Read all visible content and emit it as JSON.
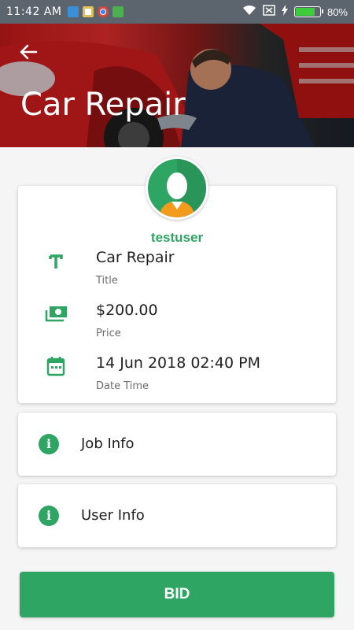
{
  "status_bar": {
    "time": "11:42 AM",
    "battery_pct": "80%",
    "battery_level": 0.8,
    "icons": [
      "usb-icon",
      "slack-icon",
      "chrome-icon",
      "android-icon",
      "wifi-icon",
      "no-sim-icon",
      "charging-icon",
      "battery-icon"
    ]
  },
  "header": {
    "title": "Car Repair",
    "back_icon": "arrow-left-icon"
  },
  "profile": {
    "username": "testuser",
    "avatar_icon": "person-silhouette-icon"
  },
  "details": [
    {
      "icon": "title-t-icon",
      "value": "Car Repair",
      "label": "Title"
    },
    {
      "icon": "money-icon",
      "value": "$200.00",
      "label": "Price"
    },
    {
      "icon": "calendar-icon",
      "value": "14 Jun 2018 02:40 PM",
      "label": "Date Time"
    }
  ],
  "sections": [
    {
      "icon": "info-icon",
      "label": "Job Info"
    },
    {
      "icon": "info-icon",
      "label": "User Info"
    }
  ],
  "actions": {
    "bid_label": "BID"
  },
  "colors": {
    "accent": "#2ea563",
    "status_bar": "#5c646d",
    "background": "#f5f5f5"
  }
}
